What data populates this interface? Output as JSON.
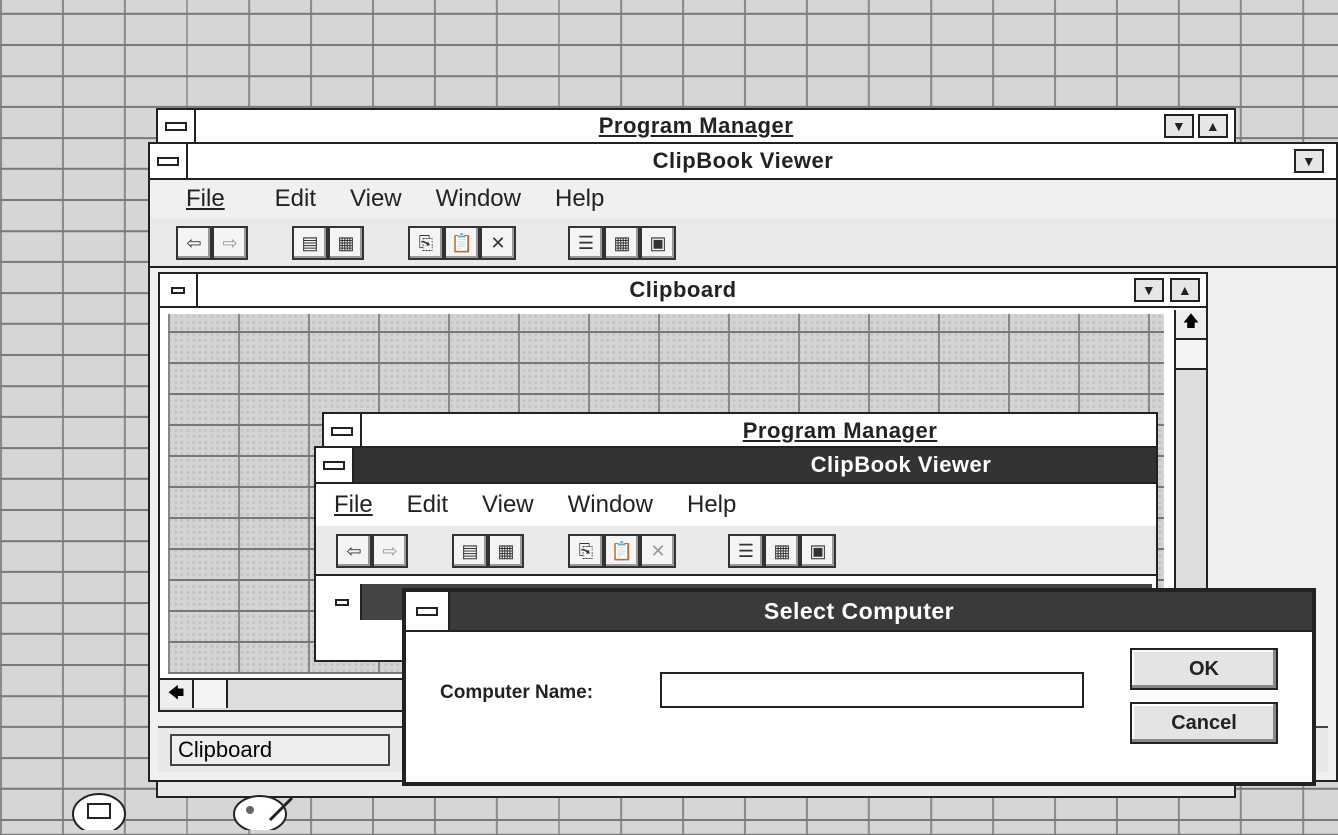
{
  "back_program_manager": {
    "title": "Program Manager"
  },
  "clipbook_viewer": {
    "title": "ClipBook Viewer",
    "menu": [
      {
        "label": "File"
      },
      {
        "label": "Edit"
      },
      {
        "label": "View"
      },
      {
        "label": "Window"
      },
      {
        "label": "Help"
      }
    ],
    "toolbar_icons": [
      "connect-icon",
      "disconnect-icon",
      "share-icon",
      "stop-sharing-icon",
      "copy-icon",
      "paste-icon",
      "delete-icon",
      "table-of-contents-icon",
      "thumbnails-icon",
      "full-page-icon"
    ]
  },
  "clipboard_window": {
    "title": "Clipboard"
  },
  "nested_screenshot": {
    "program_manager_title": "Program Manager",
    "clipbook_title": "ClipBook Viewer",
    "menu": [
      {
        "label": "File"
      },
      {
        "label": "Edit"
      },
      {
        "label": "View"
      },
      {
        "label": "Window"
      },
      {
        "label": "Help"
      }
    ]
  },
  "dialog": {
    "title": "Select Computer",
    "field_label": "Computer Name:",
    "field_value": "",
    "ok_label": "OK",
    "cancel_label": "Cancel"
  },
  "status_bar": {
    "text": "Clipboard"
  }
}
